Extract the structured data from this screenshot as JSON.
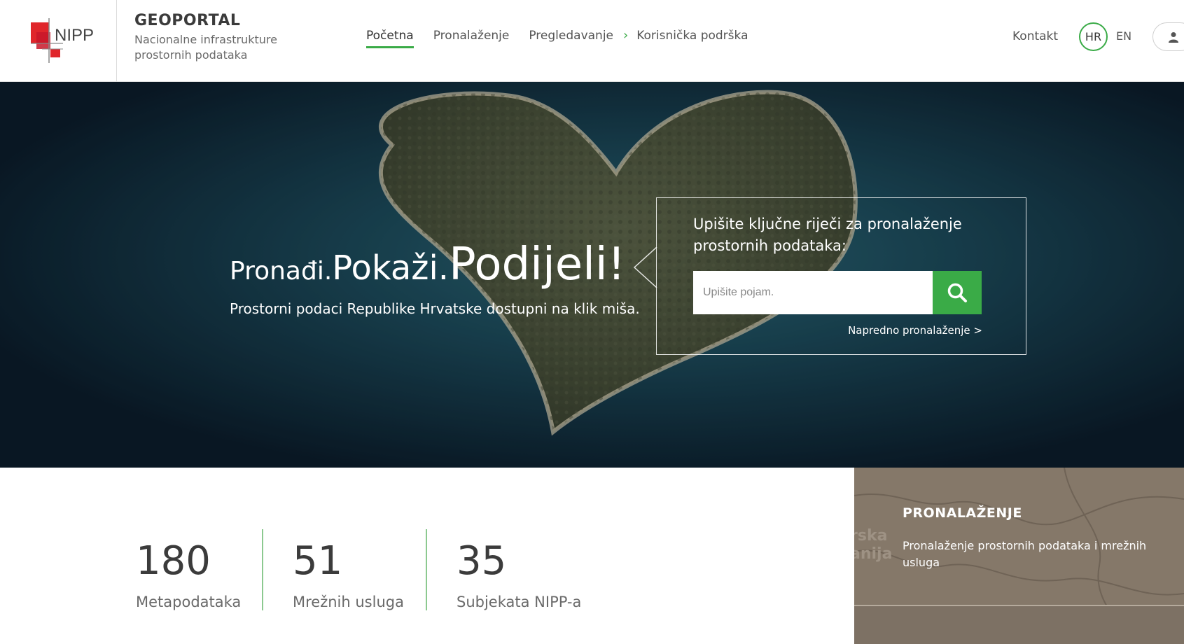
{
  "header": {
    "logo_text": "NIPP",
    "site_title": "GEOPORTAL",
    "site_subtitle": "Nacionalne infrastrukture prostornih podataka",
    "nav": [
      {
        "label": "Početna",
        "active": true
      },
      {
        "label": "Pronalaženje",
        "active": false
      },
      {
        "label": "Pregledavanje",
        "active": false
      },
      {
        "label": "Korisnička podrška",
        "active": false
      }
    ],
    "kontakt": "Kontakt",
    "lang_hr": "HR",
    "lang_en": "EN",
    "accent_color": "#3aab47"
  },
  "hero": {
    "tagline_1": "Pronađi.",
    "tagline_2": "Pokaži.",
    "tagline_3": "Podijeli!",
    "subtitle": "Prostorni podaci Republike Hrvatske dostupni na klik miša.",
    "search_label": "Upišite ključne riječi za pronalaženje prostornih podataka:",
    "search_placeholder": "Upišite pojam.",
    "advanced_link": "Napredno pronalaženje >"
  },
  "stats": [
    {
      "value": "180",
      "label": "Metapodataka"
    },
    {
      "value": "51",
      "label": "Mrežnih usluga"
    },
    {
      "value": "35",
      "label": "Subjekata NIPP-a"
    }
  ],
  "card": {
    "title": "PRONALAŽENJE",
    "text": "Pronalaženje prostornih podataka i mrežnih usluga",
    "map_label": "rska\nanija"
  }
}
